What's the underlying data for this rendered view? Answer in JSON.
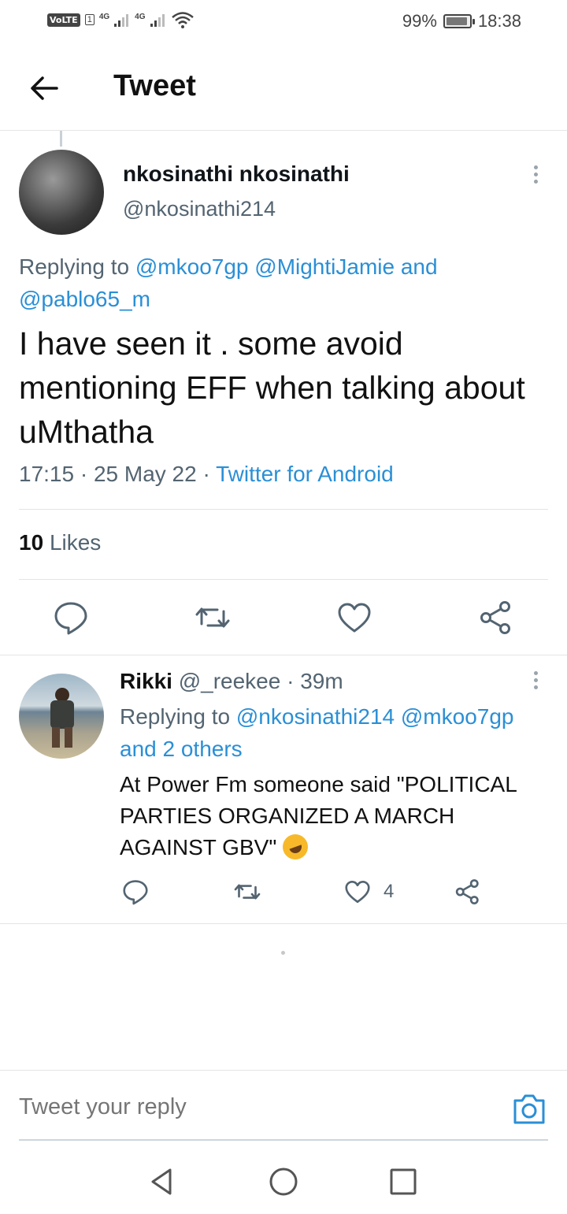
{
  "status_bar": {
    "network_badge": "VoLTE",
    "sim": "1",
    "signal1": "4G",
    "signal2": "4G",
    "battery": "99%",
    "time": "18:38"
  },
  "header": {
    "title": "Tweet"
  },
  "tweet": {
    "author_name": "nkosinathi nkosinathi",
    "author_handle": "@nkosinathi214",
    "replying_prefix": "Replying to",
    "replying_mentions": "@mkoo7gp @MightiJamie and @pablo65_m",
    "text": "I have seen it . some avoid mentioning EFF when talking about uMthatha",
    "time_date": "17:15 · 25 May 22 ·",
    "source": "Twitter for Android",
    "likes_count": "10",
    "likes_label": "Likes"
  },
  "reply": {
    "author_name": "Rikki",
    "author_meta": "@_reekee · 39m",
    "replying_prefix": "Replying to",
    "replying_mentions": "@nkosinathi214 @mkoo7gp and 2 others",
    "text": "At Power Fm someone said \"POLITICAL PARTIES ORGANIZED A MARCH AGAINST GBV\"",
    "like_count": "4"
  },
  "compose": {
    "placeholder": "Tweet your reply"
  },
  "icons": {
    "back": "arrow-left-icon",
    "reply": "comment-icon",
    "retweet": "retweet-icon",
    "like": "heart-icon",
    "share": "share-icon",
    "camera": "camera-icon",
    "emoji": "rolling-laughing-emoji"
  },
  "colors": {
    "accent": "#2a8fd6",
    "secondary_text": "#536471",
    "primary_text": "#0f1419"
  }
}
